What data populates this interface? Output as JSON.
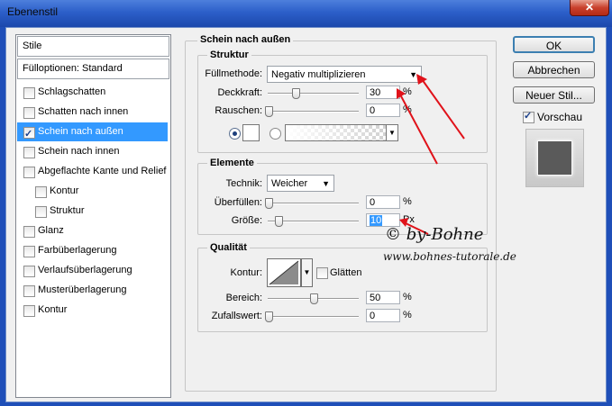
{
  "window": {
    "title": "Ebenenstil",
    "close": "✕"
  },
  "sidebar": {
    "header": "Stile",
    "blend_options": "Fülloptionen: Standard",
    "items": [
      {
        "label": "Schlagschatten",
        "checked": false
      },
      {
        "label": "Schatten nach innen",
        "checked": false
      },
      {
        "label": "Schein nach außen",
        "checked": true
      },
      {
        "label": "Schein nach innen",
        "checked": false
      },
      {
        "label": "Abgeflachte Kante und Relief",
        "checked": false
      },
      {
        "label": "Kontur",
        "checked": false
      },
      {
        "label": "Struktur",
        "checked": false
      },
      {
        "label": "Glanz",
        "checked": false
      },
      {
        "label": "Farbüberlagerung",
        "checked": false
      },
      {
        "label": "Verlaufsüberlagerung",
        "checked": false
      },
      {
        "label": "Musterüberlagerung",
        "checked": false
      },
      {
        "label": "Kontur",
        "checked": false
      }
    ]
  },
  "panel": {
    "title": "Schein nach außen",
    "structure": {
      "title": "Struktur",
      "blend_mode_label": "Füllmethode:",
      "blend_mode": "Negativ multiplizieren",
      "opacity_label": "Deckkraft:",
      "opacity": "30",
      "opacity_unit": "%",
      "noise_label": "Rauschen:",
      "noise": "0",
      "noise_unit": "%"
    },
    "elements": {
      "title": "Elemente",
      "technique_label": "Technik:",
      "technique": "Weicher",
      "spread_label": "Überfüllen:",
      "spread": "0",
      "spread_unit": "%",
      "size_label": "Größe:",
      "size": "10",
      "size_unit": "Px"
    },
    "quality": {
      "title": "Qualität",
      "contour_label": "Kontur:",
      "antialias_label": "Glätten",
      "range_label": "Bereich:",
      "range": "50",
      "range_unit": "%",
      "jitter_label": "Zufallswert:",
      "jitter": "0",
      "jitter_unit": "%"
    }
  },
  "buttons": {
    "ok": "OK",
    "cancel": "Abbrechen",
    "new_style": "Neuer Stil...",
    "preview_label": "Vorschau"
  },
  "watermark": {
    "line1": "© by-Bohne",
    "line2": "www.bohnes-tutorale.de"
  },
  "colors": {
    "selection": "#3399ff",
    "arrow": "#e0121a",
    "glow_color": "#ffffff"
  }
}
